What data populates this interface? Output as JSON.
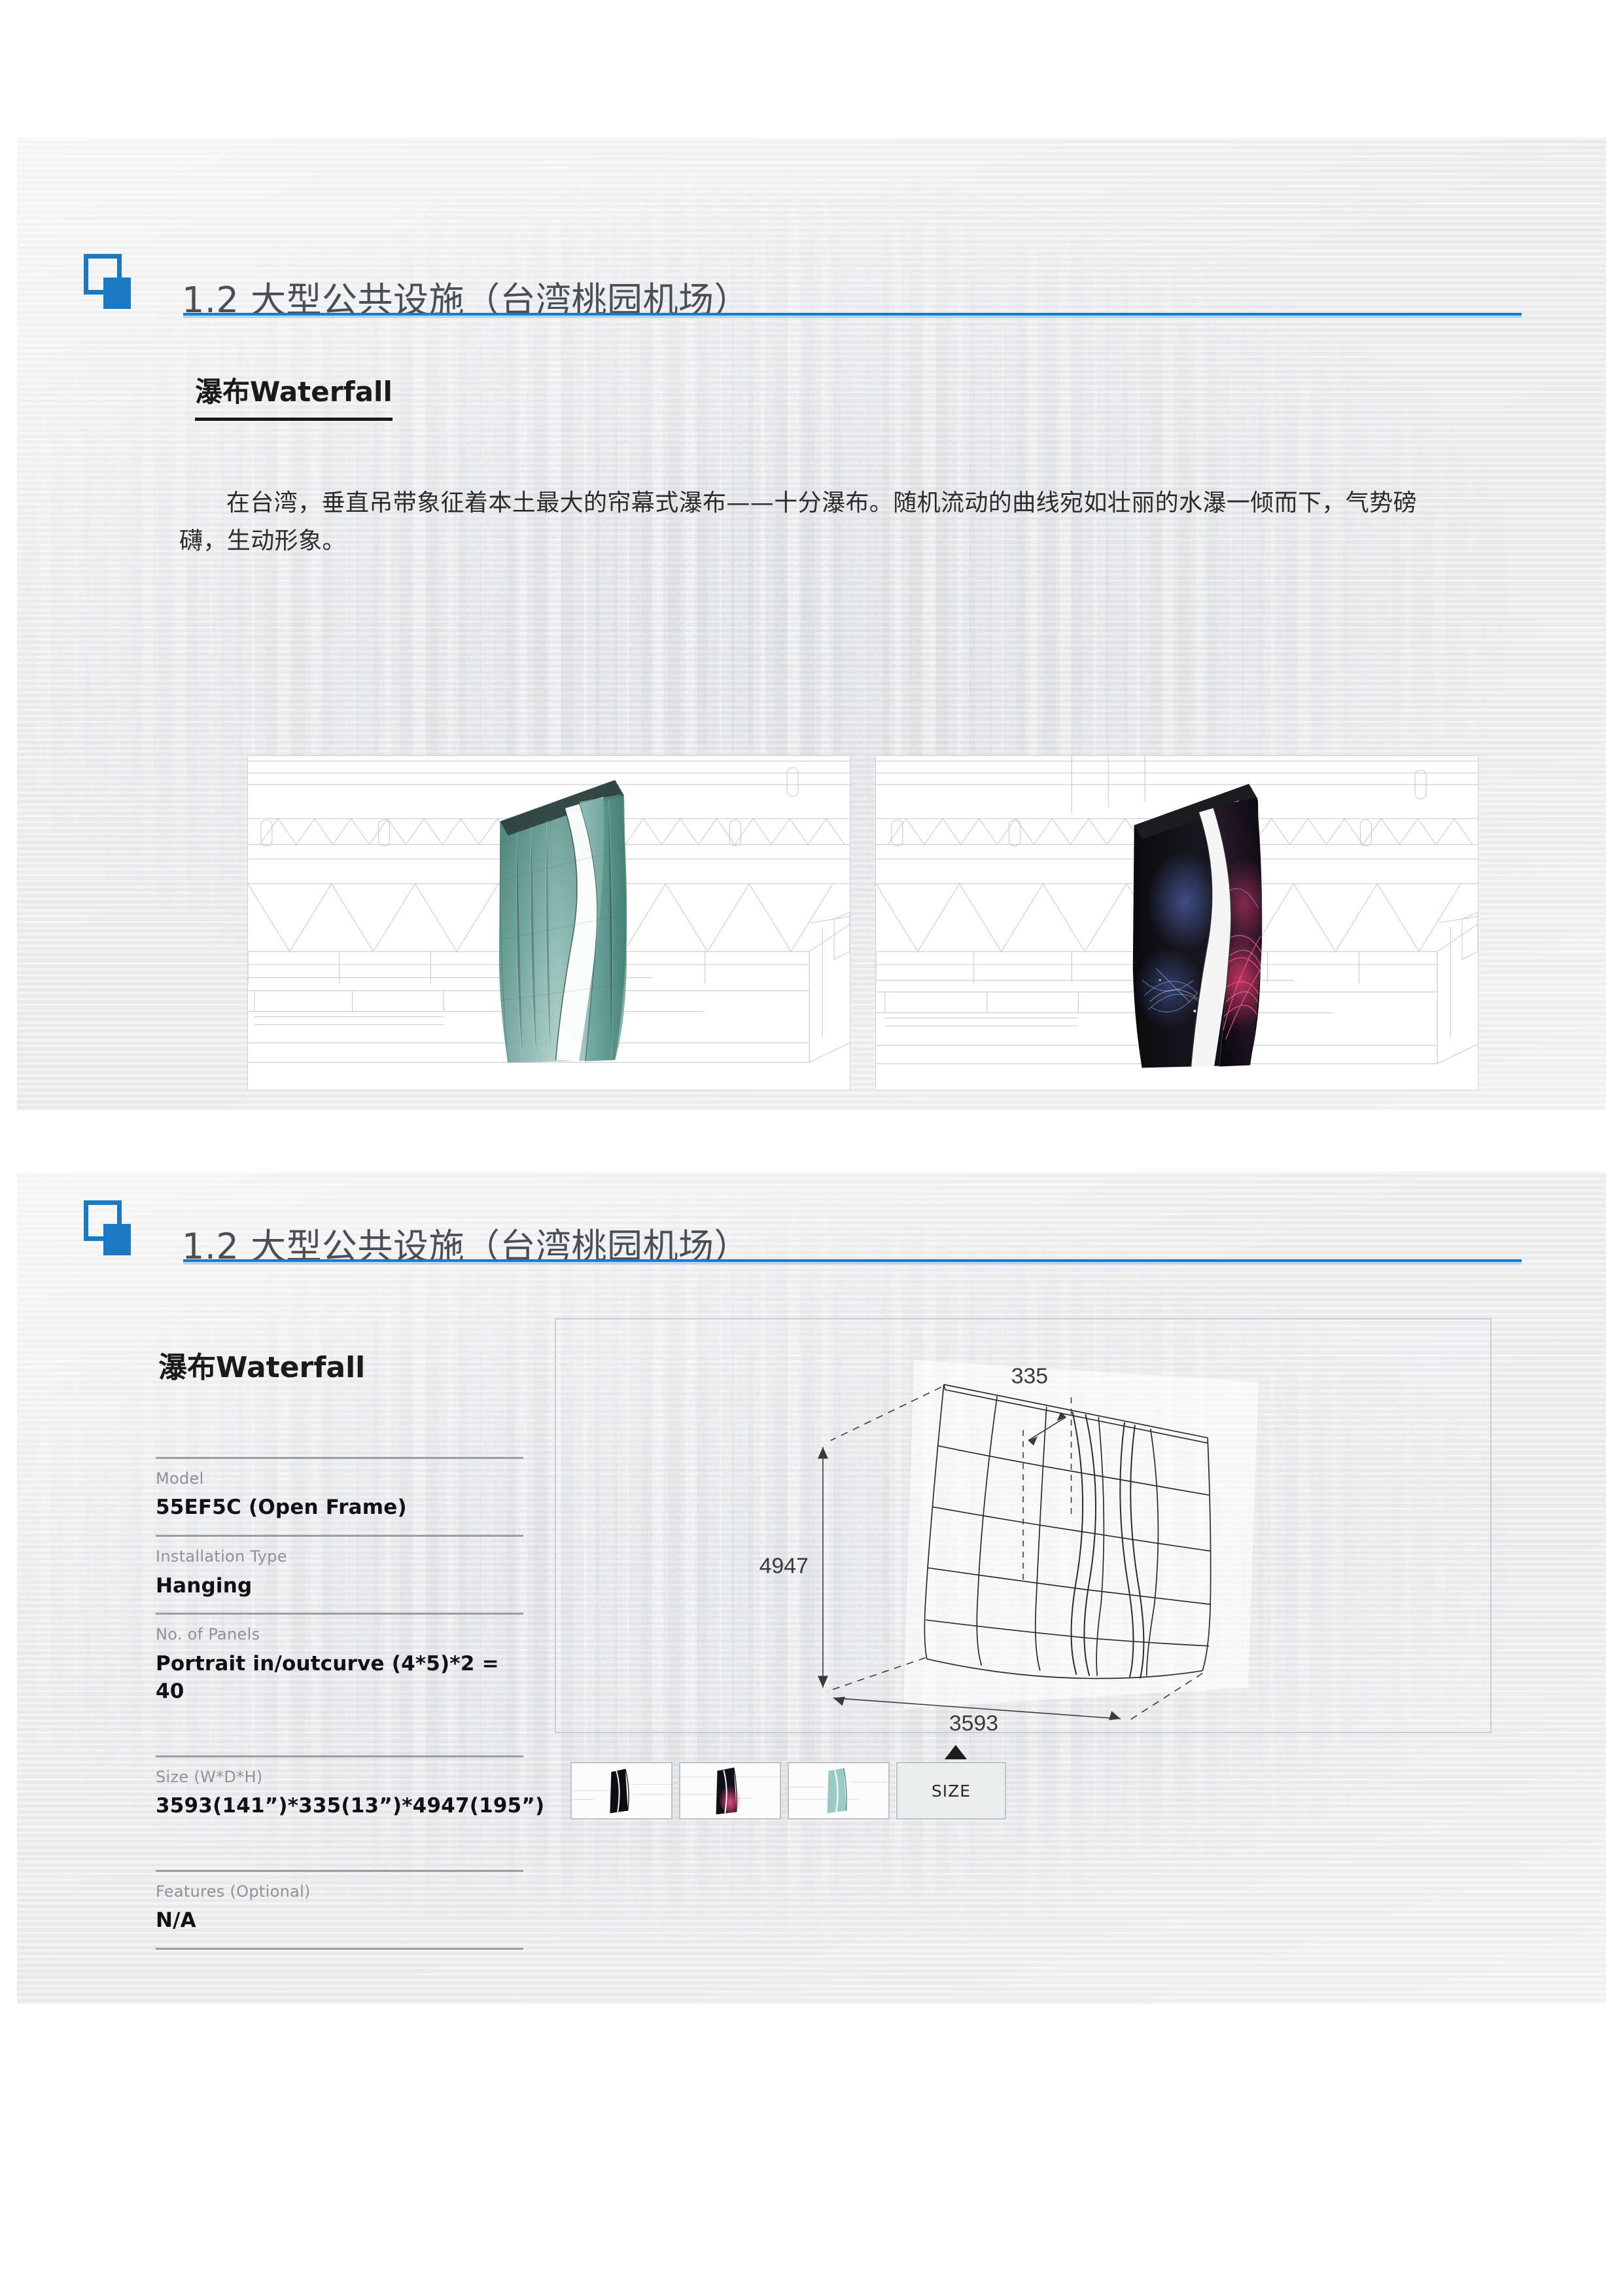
{
  "theme": {
    "accent_blue": "#1b79c4",
    "rule_light_blue": "#b9d5ec",
    "slide_bg": "#e8e9eb",
    "title_gray": "#4b4f55",
    "label_gray": "#8e9196"
  },
  "slide1": {
    "title": "1.2 大型公共设施（台湾桃园机场）",
    "heading": "瀑布Waterfall",
    "body": "在台湾，垂直吊带象征着本土最大的帘幕式瀑布——十分瀑布。随机流动的曲线宛如壮丽的水瀑一倾而下，气势磅礴，生动形象。",
    "photos": [
      {
        "name": "waterfall-render-green",
        "caption": ""
      },
      {
        "name": "waterfall-render-dark",
        "caption": ""
      }
    ]
  },
  "slide2": {
    "title": "1.2 大型公共设施（台湾桃园机场）",
    "heading": "瀑布Waterfall",
    "specs": [
      {
        "label": "Model",
        "value": "55EF5C (Open Frame)"
      },
      {
        "label": "Installation Type",
        "value": "Hanging"
      },
      {
        "label": "No. of Panels",
        "value": "Portrait in/outcurve (4*5)*2 = 40"
      },
      {
        "label": "Size (W*D*H)",
        "value": "3593(141”)*335(13”)*4947(195”)"
      },
      {
        "label": "Features (Optional)",
        "value": "N/A"
      }
    ],
    "drawing": {
      "dim_depth": "335",
      "dim_height": "4947",
      "dim_width": "3593"
    },
    "thumbnails": [
      {
        "name": "thumb-dark-front"
      },
      {
        "name": "thumb-dark-lit"
      },
      {
        "name": "thumb-green"
      }
    ],
    "size_tab_label": "SIZE"
  }
}
